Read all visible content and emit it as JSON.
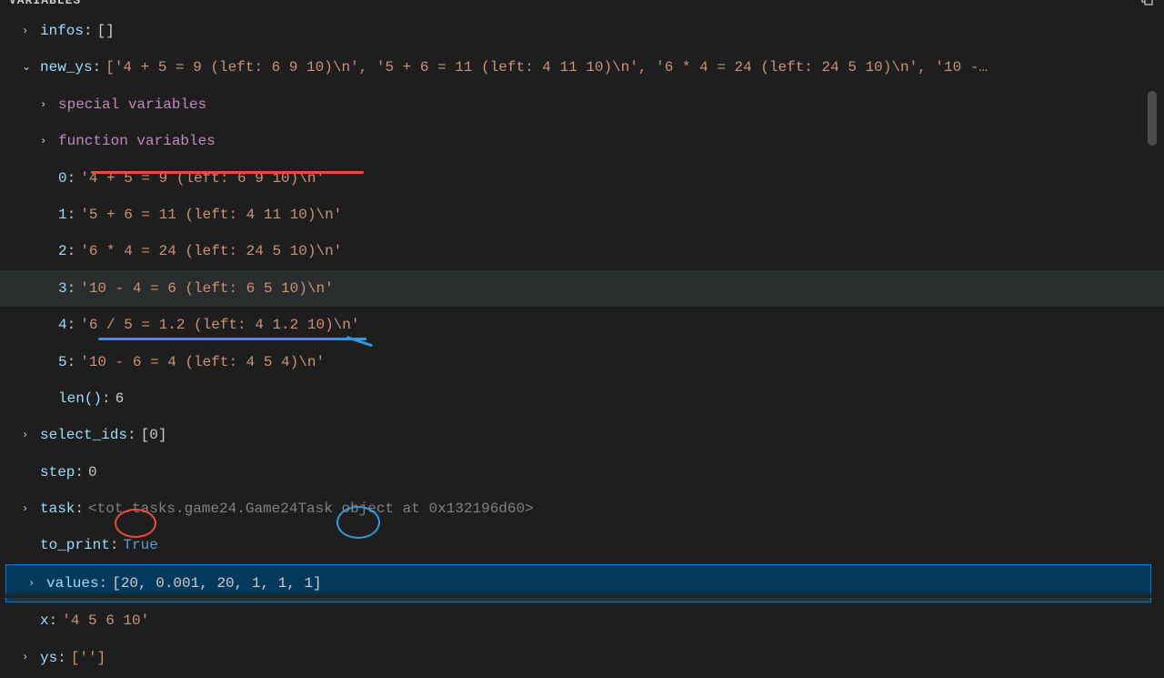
{
  "panel": {
    "title": "VARIABLES"
  },
  "vars": {
    "infos": {
      "name": "infos",
      "value": "[]"
    },
    "new_ys": {
      "name": "new_ys",
      "preview": "['4 + 5 = 9 (left: 6 9 10)\\n', '5 + 6 = 11 (left: 4 11 10)\\n', '6 * 4 = 24 (left: 24 5 10)\\n', '10 -…",
      "special": "special variables",
      "function": "function variables",
      "items": [
        {
          "idx": "0",
          "val": "'4 + 5 = 9 (left: 6 9 10)\\n'"
        },
        {
          "idx": "1",
          "val": "'5 + 6 = 11 (left: 4 11 10)\\n'"
        },
        {
          "idx": "2",
          "val": "'6 * 4 = 24 (left: 24 5 10)\\n'"
        },
        {
          "idx": "3",
          "val": "'10 - 4 = 6 (left: 6 5 10)\\n'"
        },
        {
          "idx": "4",
          "val": "'6 / 5 = 1.2 (left: 4 1.2 10)\\n'"
        },
        {
          "idx": "5",
          "val": "'10 - 6 = 4 (left: 4 5 4)\\n'"
        }
      ],
      "len_label": "len()",
      "len_value": "6"
    },
    "select_ids": {
      "name": "select_ids",
      "value": "[0]"
    },
    "step": {
      "name": "step",
      "value": "0"
    },
    "task": {
      "name": "task",
      "value": "<tot.tasks.game24.Game24Task object at 0x132196d60>"
    },
    "to_print": {
      "name": "to_print",
      "value": "True"
    },
    "values": {
      "name": "values",
      "value": "[20, 0.001, 20, 1, 1, 1]"
    },
    "x": {
      "name": "x",
      "value": "'4 5 6 10'"
    },
    "ys": {
      "name": "ys",
      "value": "['']"
    }
  }
}
